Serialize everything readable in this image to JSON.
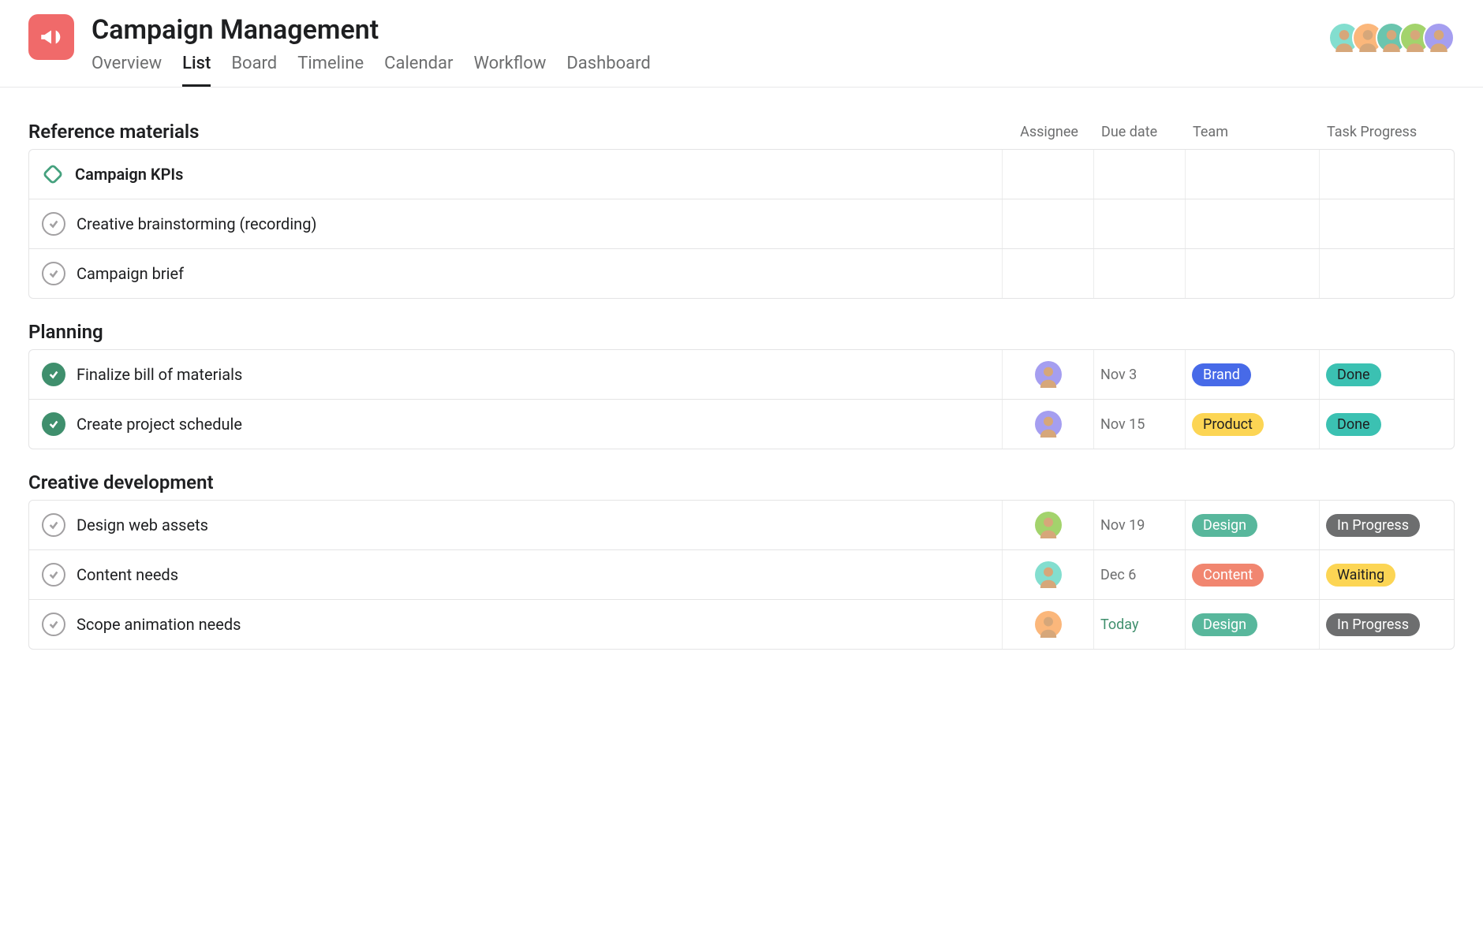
{
  "project": {
    "title": "Campaign Management"
  },
  "tabs": [
    {
      "label": "Overview",
      "active": false
    },
    {
      "label": "List",
      "active": true
    },
    {
      "label": "Board",
      "active": false
    },
    {
      "label": "Timeline",
      "active": false
    },
    {
      "label": "Calendar",
      "active": false
    },
    {
      "label": "Workflow",
      "active": false
    },
    {
      "label": "Dashboard",
      "active": false
    }
  ],
  "collaborators": [
    {
      "bg": "#83decf"
    },
    {
      "bg": "#fbb77b"
    },
    {
      "bg": "#6ac5ae"
    },
    {
      "bg": "#a3d36c"
    },
    {
      "bg": "#a59ef0"
    }
  ],
  "columns": {
    "assignee": "Assignee",
    "due": "Due date",
    "team": "Team",
    "progress": "Task Progress"
  },
  "sections": [
    {
      "title": "Reference materials",
      "show_cols": true,
      "tasks": [
        {
          "name": "Campaign KPIs",
          "milestone": true,
          "bold": true,
          "completed": false,
          "assignee": null,
          "due": "",
          "team": null,
          "progress": null
        },
        {
          "name": "Creative brainstorming (recording)",
          "milestone": false,
          "bold": false,
          "completed": false,
          "assignee": null,
          "due": "",
          "team": null,
          "progress": null
        },
        {
          "name": "Campaign brief",
          "milestone": false,
          "bold": false,
          "completed": false,
          "assignee": null,
          "due": "",
          "team": null,
          "progress": null
        }
      ]
    },
    {
      "title": "Planning",
      "show_cols": false,
      "tasks": [
        {
          "name": "Finalize bill of materials",
          "milestone": false,
          "bold": false,
          "completed": true,
          "assignee": {
            "bg": "#a59ef0"
          },
          "due": "Nov 3",
          "due_today": false,
          "team": {
            "label": "Brand",
            "cls": "bg-blue"
          },
          "progress": {
            "label": "Done",
            "cls": "bg-done"
          }
        },
        {
          "name": "Create project schedule",
          "milestone": false,
          "bold": false,
          "completed": true,
          "assignee": {
            "bg": "#a59ef0"
          },
          "due": "Nov 15",
          "due_today": false,
          "team": {
            "label": "Product",
            "cls": "bg-yellow"
          },
          "progress": {
            "label": "Done",
            "cls": "bg-done"
          }
        }
      ]
    },
    {
      "title": "Creative development",
      "show_cols": false,
      "tasks": [
        {
          "name": "Design web assets",
          "milestone": false,
          "bold": false,
          "completed": false,
          "assignee": {
            "bg": "#a3d36c"
          },
          "due": "Nov 19",
          "due_today": false,
          "team": {
            "label": "Design",
            "cls": "bg-darkteal"
          },
          "progress": {
            "label": "In Progress",
            "cls": "bg-gray"
          }
        },
        {
          "name": "Content needs",
          "milestone": false,
          "bold": false,
          "completed": false,
          "assignee": {
            "bg": "#83decf"
          },
          "due": "Dec 6",
          "due_today": false,
          "team": {
            "label": "Content",
            "cls": "bg-salmon"
          },
          "progress": {
            "label": "Waiting",
            "cls": "bg-wait"
          }
        },
        {
          "name": "Scope animation needs",
          "milestone": false,
          "bold": false,
          "completed": false,
          "assignee": {
            "bg": "#fbb77b"
          },
          "due": "Today",
          "due_today": true,
          "team": {
            "label": "Design",
            "cls": "bg-darkteal"
          },
          "progress": {
            "label": "In Progress",
            "cls": "bg-gray"
          }
        }
      ]
    }
  ]
}
